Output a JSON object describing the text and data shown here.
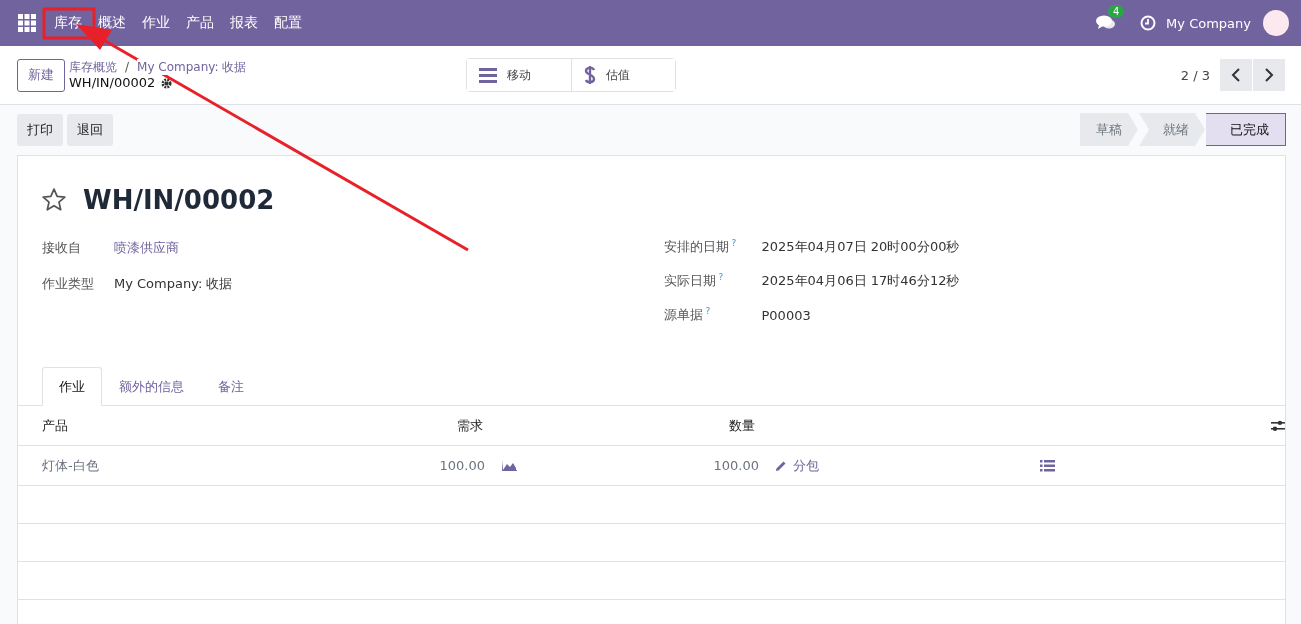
{
  "navbar": {
    "menus": [
      "库存",
      "概述",
      "作业",
      "产品",
      "报表",
      "配置"
    ],
    "messages_count": "4",
    "company": "My Company"
  },
  "control_panel": {
    "new_button": "新建",
    "breadcrumbs": [
      "库存概览",
      "My Company: 收据"
    ],
    "separator": "/",
    "record": "WH/IN/00002",
    "smart_buttons": [
      {
        "label": "移动",
        "kind": "list"
      },
      {
        "label": "估值",
        "kind": "dollar"
      }
    ],
    "pager": "2 / 3"
  },
  "actions": [
    "打印",
    "退回"
  ],
  "status_steps": [
    {
      "label": "草稿",
      "selected": false
    },
    {
      "label": "就绪",
      "selected": false
    },
    {
      "label": "已完成",
      "selected": true
    }
  ],
  "form": {
    "title": "WH/IN/00002",
    "starred": false,
    "left_fields": [
      {
        "label": "接收自",
        "value": "喷漆供应商",
        "kind": "link"
      },
      {
        "label": "作业类型",
        "value": "My Company: 收据",
        "kind": "text"
      }
    ],
    "right_fields": [
      {
        "label": "安排的日期",
        "help": "?",
        "value": "2025年04月07日 20时00分00秒"
      },
      {
        "label": "实际日期",
        "help": "?",
        "value": "2025年04月06日 17时46分12秒"
      },
      {
        "label": "源单据",
        "help": "?",
        "value": "P00003"
      }
    ]
  },
  "tabs": [
    {
      "label": "作业",
      "selected": true
    },
    {
      "label": "额外的信息",
      "selected": false
    },
    {
      "label": "备注",
      "selected": false
    }
  ],
  "table": {
    "columns": [
      "产品",
      "需求",
      "数量"
    ],
    "rows": [
      {
        "product": "灯体-白色",
        "demand": "100.00",
        "quantity": "100.00",
        "action": "分包"
      }
    ]
  }
}
